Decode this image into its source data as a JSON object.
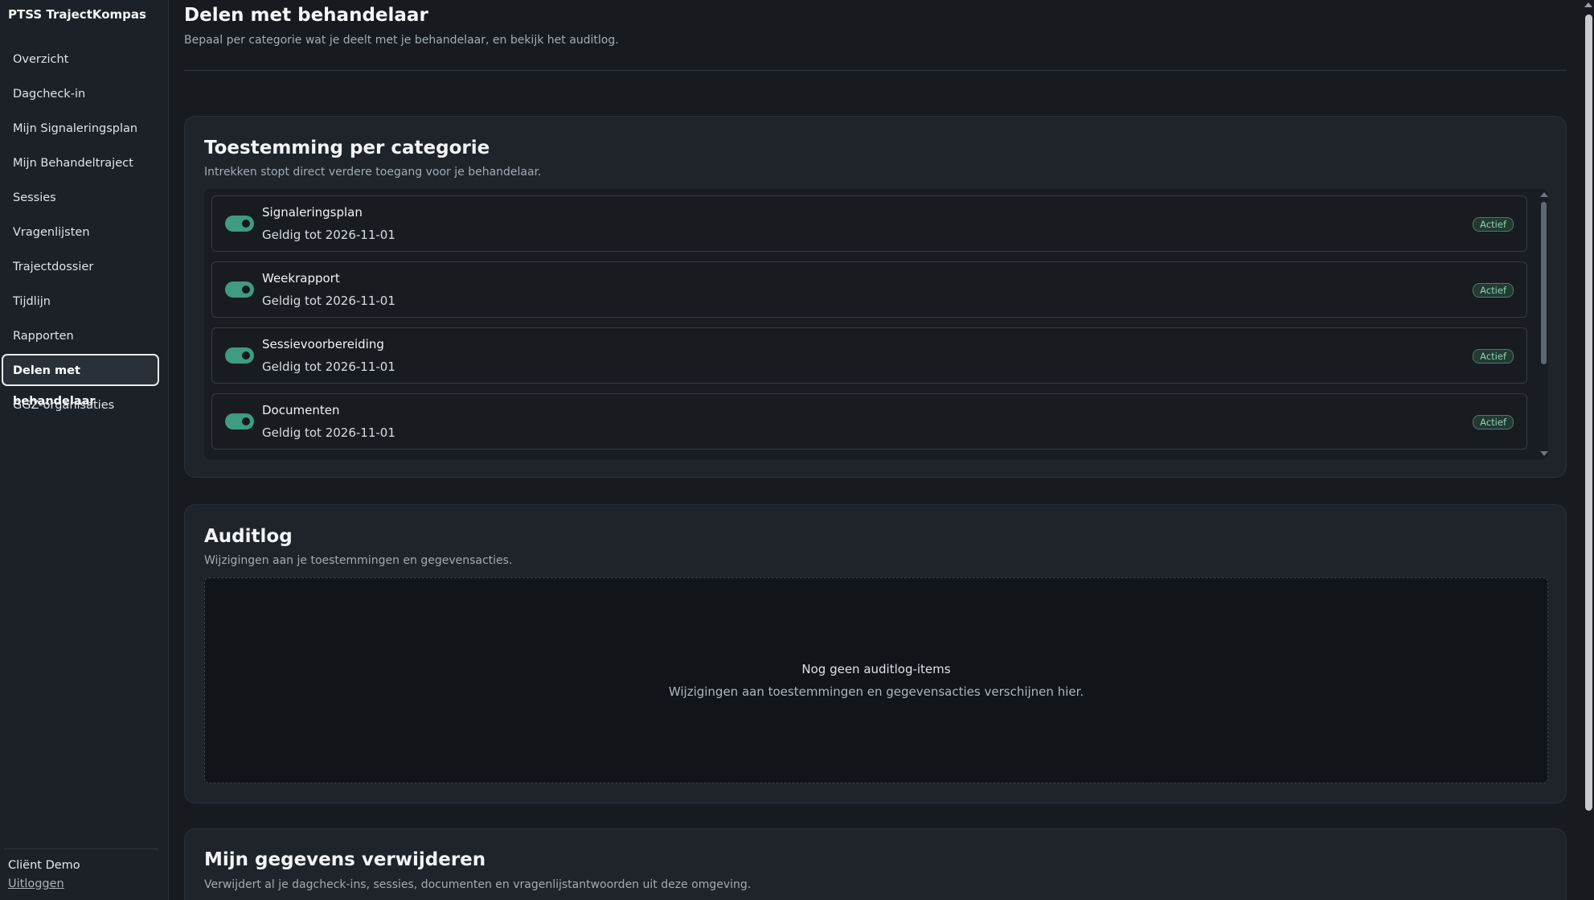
{
  "app": {
    "brand": "PTSS TrajectKompas"
  },
  "sidebar": {
    "items": [
      {
        "label": "Overzicht"
      },
      {
        "label": "Dagcheck-in"
      },
      {
        "label": "Mijn Signaleringsplan"
      },
      {
        "label": "Mijn Behandeltraject"
      },
      {
        "label": "Sessies"
      },
      {
        "label": "Vragenlijsten"
      },
      {
        "label": "Trajectdossier"
      },
      {
        "label": "Tijdlijn"
      },
      {
        "label": "Rapporten"
      },
      {
        "label": "Delen met behandelaar",
        "active": true
      },
      {
        "label": "GGZ-organisaties"
      }
    ],
    "user": "Cliënt Demo",
    "logout": "Uitloggen"
  },
  "page": {
    "title": "Delen met behandelaar",
    "subtitle": "Bepaal per categorie wat je deelt met je behandelaar, en bekijk het auditlog."
  },
  "consent": {
    "title": "Toestemming per categorie",
    "subtitle": "Intrekken stopt direct verdere toegang voor je behandelaar.",
    "items": [
      {
        "name": "Signaleringsplan",
        "valid": "Geldig tot 2026-11-01",
        "status": "Actief",
        "enabled": true
      },
      {
        "name": "Weekrapport",
        "valid": "Geldig tot 2026-11-01",
        "status": "Actief",
        "enabled": true
      },
      {
        "name": "Sessievoorbereiding",
        "valid": "Geldig tot 2026-11-01",
        "status": "Actief",
        "enabled": true
      },
      {
        "name": "Documenten",
        "valid": "Geldig tot 2026-11-01",
        "status": "Actief",
        "enabled": true
      }
    ]
  },
  "audit": {
    "title": "Auditlog",
    "subtitle": "Wijzigingen aan je toestemmingen en gegevensacties.",
    "empty_title": "Nog geen auditlog-items",
    "empty_text": "Wijzigingen aan toestemmingen en gegevensacties verschijnen hier."
  },
  "delete": {
    "title": "Mijn gegevens verwijderen",
    "subtitle": "Verwijdert al je dagcheck-ins, sessies, documenten en vragenlijstantwoorden uit deze omgeving."
  },
  "colors": {
    "background": "#171b20",
    "sidebar": "#1c2127",
    "card": "#1f242b",
    "toggle_on": "#3f9b82",
    "badge_text": "#8fd1b8"
  }
}
